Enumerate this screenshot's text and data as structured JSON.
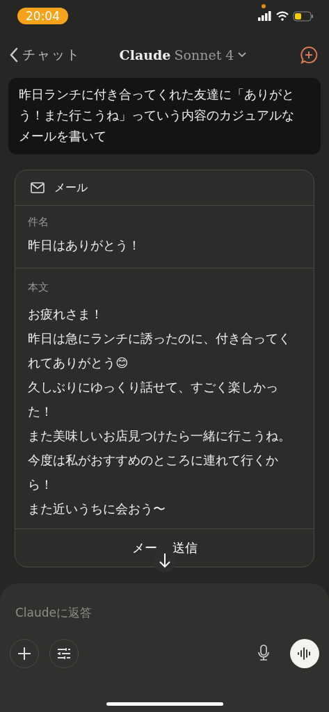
{
  "status_bar": {
    "time": "20:04"
  },
  "header": {
    "back_label": "チャット",
    "model_name": "Claude",
    "model_version": "Sonnet 4"
  },
  "user_message": "昨日ランチに付き合ってくれた友達に「ありがとう！また行こうね」っていう内容のカジュアルなメールを書いて",
  "email_card": {
    "title": "メール",
    "subject_label": "件名",
    "subject": "昨日はありがとう！",
    "body_label": "本文",
    "body": [
      {
        "text": "お疲れさま！"
      },
      {
        "text": "昨日は急にランチに誘ったのに、付き合ってくれてありがとう😊"
      },
      {
        "text": "久しぶりにゆっくり話せて、すごく楽しかった！"
      },
      {
        "text": "また美味しいお店見つけたら一緒に行こうね。"
      },
      {
        "text": "今度は私がおすすめのところに連れて行くから！"
      },
      {
        "text": "また近いうちに会おう〜"
      }
    ],
    "send_button": [
      "メー",
      "送信"
    ]
  },
  "composer": {
    "placeholder": "Claudeに返答"
  }
}
